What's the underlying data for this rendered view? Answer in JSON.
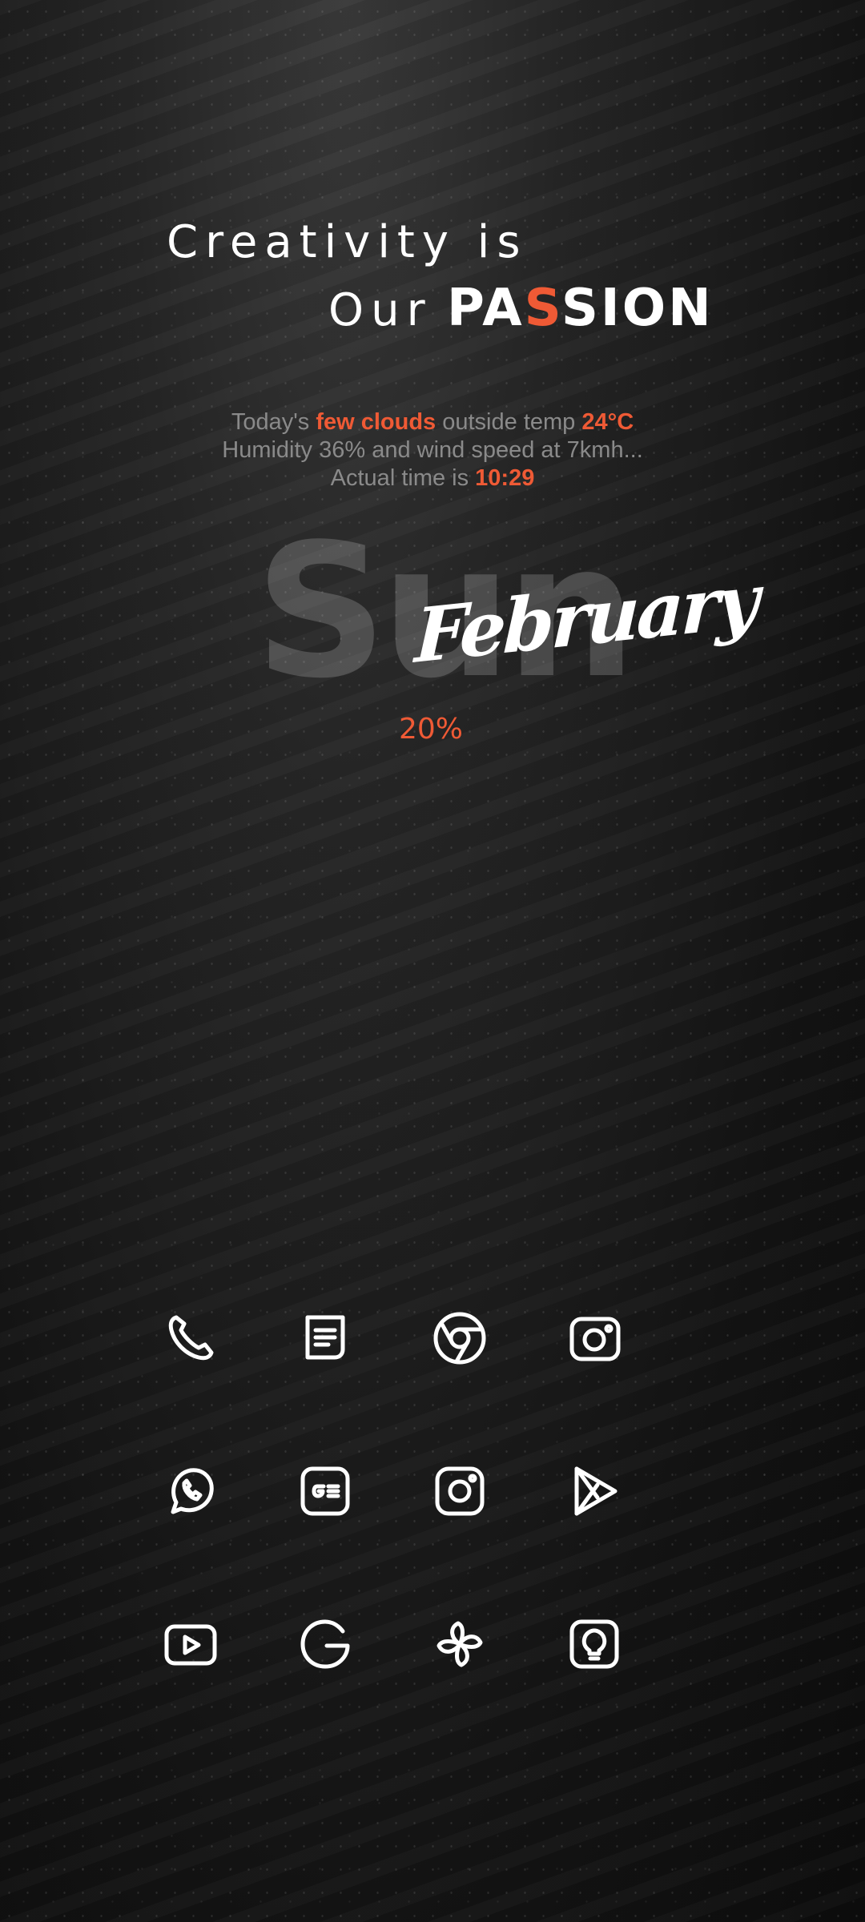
{
  "headline": {
    "line1": "Creativity is",
    "line2_prefix": "Our",
    "passion_pre": "PA",
    "passion_accent": "S",
    "passion_post": "SION"
  },
  "weather": {
    "l1_a": "Today's ",
    "condition": "few clouds",
    "l1_b": " outside temp ",
    "temp": "24°C",
    "line2": "Humidity 36% and wind speed at 7kmh...",
    "l3_a": "Actual time is ",
    "time": "10:29"
  },
  "date": {
    "day": "Sun",
    "month": "February"
  },
  "battery": "20%",
  "colors": {
    "accent": "#ef5a35",
    "text": "#ffffff",
    "muted": "#8a8a8a"
  },
  "apps": [
    {
      "icon": "phone-icon"
    },
    {
      "icon": "messages-icon"
    },
    {
      "icon": "chrome-icon"
    },
    {
      "icon": "camera-icon"
    },
    {
      "icon": "whatsapp-icon"
    },
    {
      "icon": "google-news-icon"
    },
    {
      "icon": "instagram-icon"
    },
    {
      "icon": "play-store-icon"
    },
    {
      "icon": "youtube-icon"
    },
    {
      "icon": "google-icon"
    },
    {
      "icon": "pinwheel-icon"
    },
    {
      "icon": "lightbulb-icon"
    }
  ]
}
